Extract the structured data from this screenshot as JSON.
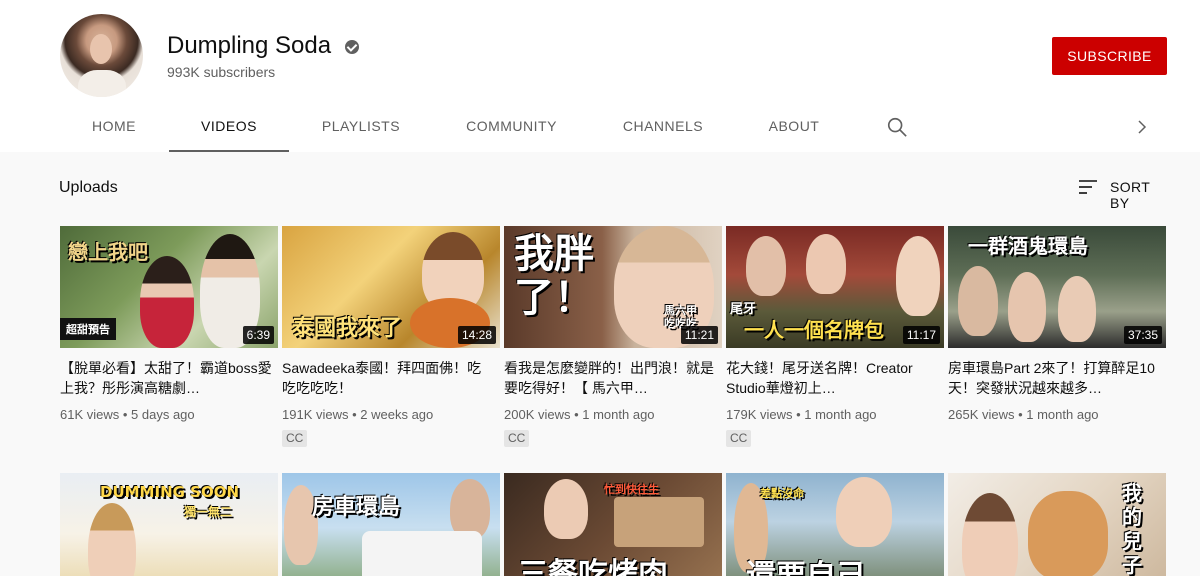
{
  "channel": {
    "name": "Dumpling Soda",
    "subscribers": "993K subscribers",
    "subscribe_label": "SUBSCRIBE"
  },
  "tabs": [
    {
      "label": "HOME"
    },
    {
      "label": "VIDEOS"
    },
    {
      "label": "PLAYLISTS"
    },
    {
      "label": "COMMUNITY"
    },
    {
      "label": "CHANNELS"
    },
    {
      "label": "ABOUT"
    }
  ],
  "icons": {
    "search": "search-icon",
    "more_tabs": "chevron-right-icon",
    "sort": "sort-icon",
    "verified": "verified-icon"
  },
  "section": {
    "title": "Uploads",
    "sort_label": "SORT BY"
  },
  "videos": [
    {
      "title": "【脫單必看】太甜了！霸道boss愛上我？彤彤演高糖劇…",
      "views": "61K views",
      "age": "5 days ago",
      "duration": "6:39",
      "cc": "",
      "thumb_text": "戀上我吧",
      "thumb_badge": "超甜預告"
    },
    {
      "title": "Sawadeeka泰國！拜四面佛！吃吃吃吃吃！",
      "views": "191K views",
      "age": "2 weeks ago",
      "duration": "14:28",
      "cc": "CC",
      "thumb_text": "泰國我來了"
    },
    {
      "title": "看我是怎麼變胖的！出門浪！就是要吃得好！【 馬六甲…",
      "views": "200K views",
      "age": "1 month ago",
      "duration": "11:21",
      "cc": "CC",
      "thumb_text": "我胖了！",
      "thumb_badge": "馬六甲吃吃吃"
    },
    {
      "title": "花大錢！尾牙送名牌！Creator Studio華燈初上…",
      "views": "179K views",
      "age": "1 month ago",
      "duration": "11:17",
      "cc": "CC",
      "thumb_text": "一人一個名牌包",
      "thumb_badge": "尾牙"
    },
    {
      "title": "房車環島Part 2來了！打算醉足10天！突發狀況越來越多…",
      "views": "265K views",
      "age": "1 month ago",
      "duration": "37:35",
      "cc": "",
      "thumb_text": "一群酒鬼環島"
    }
  ],
  "second_row_thumbs": [
    {
      "thumb_text": "DUMMING SOON",
      "thumb_badge": "獨一無二"
    },
    {
      "thumb_text": "房車環島"
    },
    {
      "thumb_text": "三餐吃烤肉",
      "thumb_badge": "忙到快往生"
    },
    {
      "thumb_text": "還要自己",
      "thumb_badge": "差點沒命"
    },
    {
      "thumb_text": "我的兒子"
    }
  ],
  "colors": {
    "subscribe": "#cc0000",
    "header_bg": "#ffffff",
    "page_bg": "#f9f9f9",
    "text_secondary": "#606060"
  }
}
